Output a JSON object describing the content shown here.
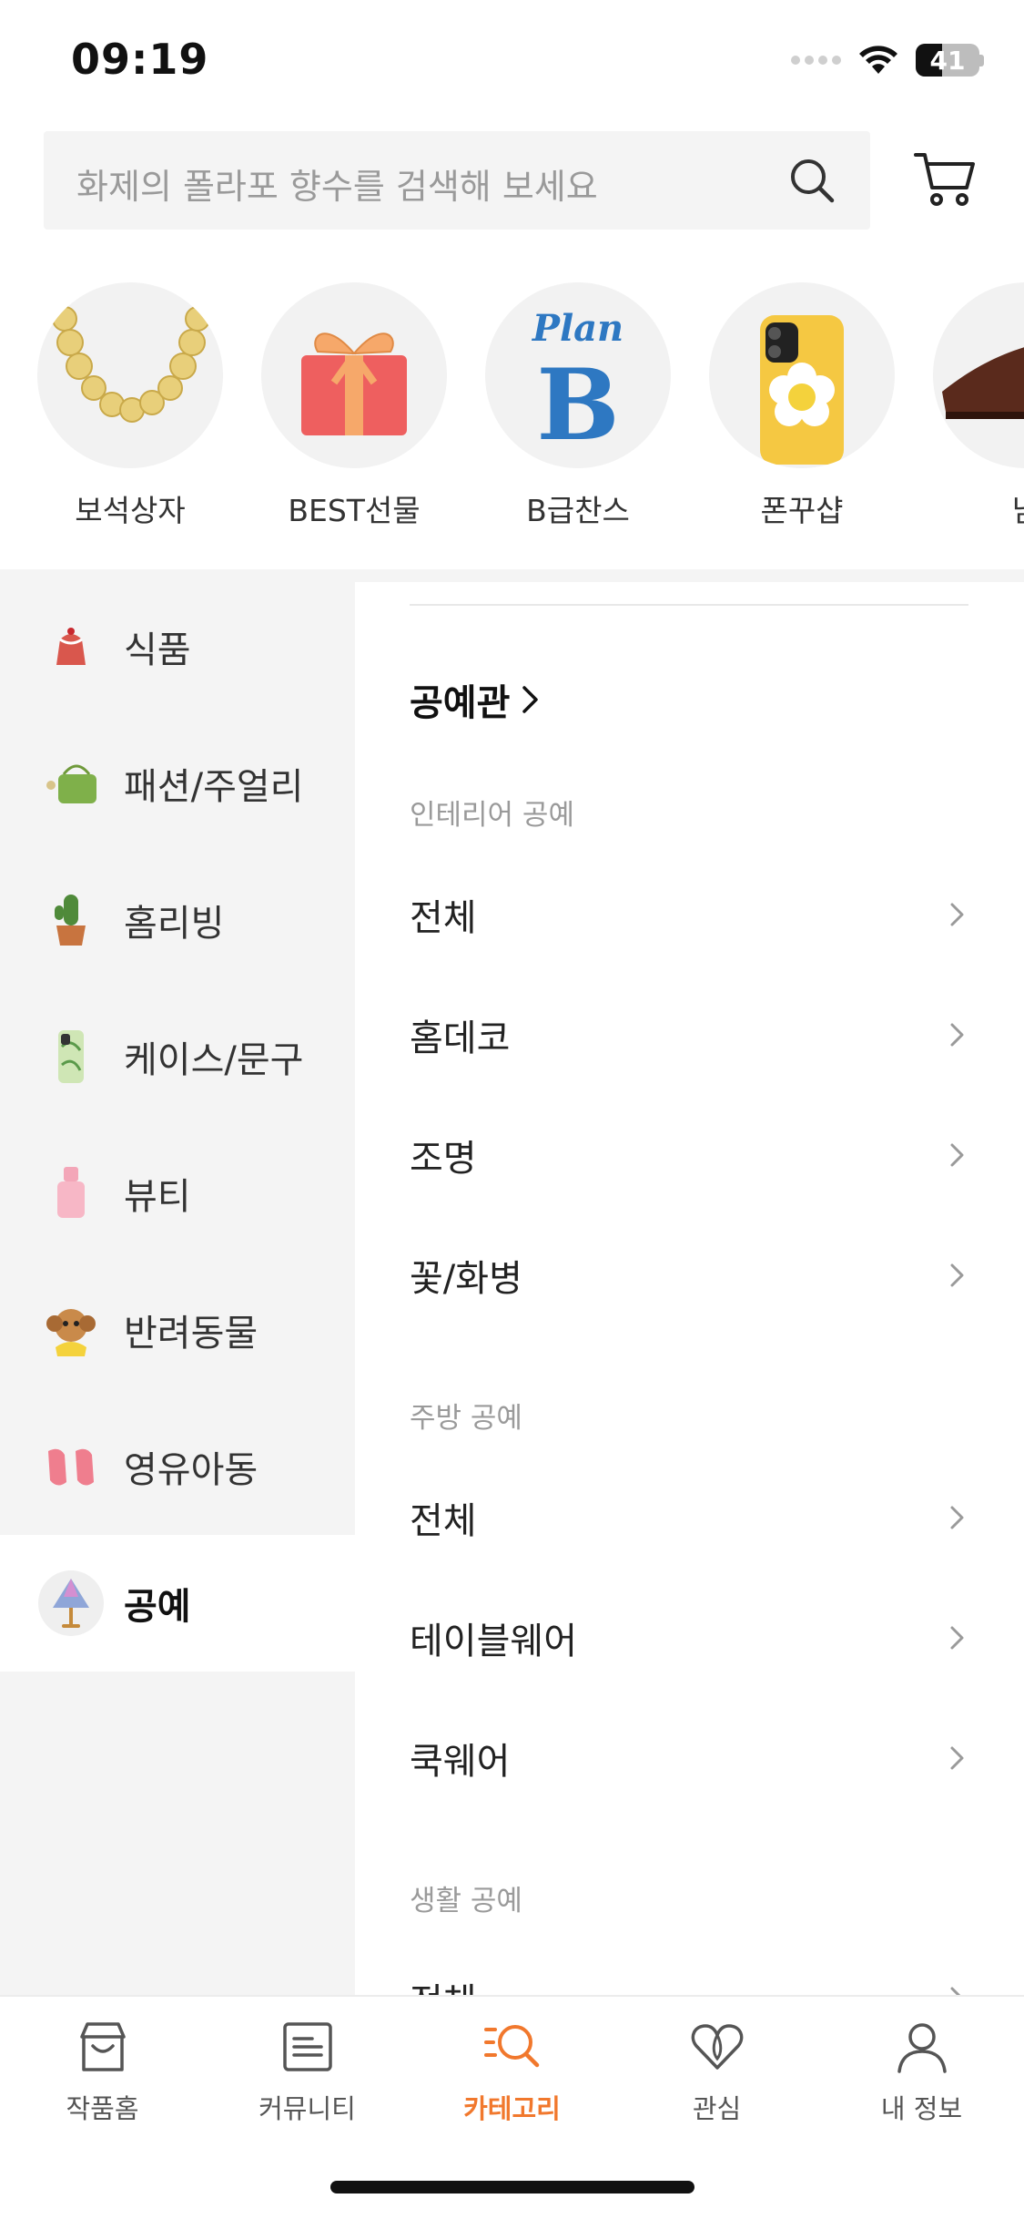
{
  "status_bar": {
    "time": "09:19",
    "battery": "41"
  },
  "search": {
    "placeholder": "화제의 폴라포 향수를 검색해 보세요"
  },
  "shortcuts": [
    {
      "label": "보석상자",
      "icon": "amber-necklace-icon"
    },
    {
      "label": "BEST선물",
      "icon": "gift-box-icon"
    },
    {
      "label": "B급찬스",
      "icon": "plan-b-logo-icon",
      "logo_text": "Plan B"
    },
    {
      "label": "폰꾸샵",
      "icon": "flower-phone-case-icon"
    },
    {
      "label": "남",
      "icon": "leather-shoe-icon"
    }
  ],
  "sidebar": {
    "items": [
      {
        "label": "식품",
        "icon": "cake-icon",
        "active": false
      },
      {
        "label": "패션/주얼리",
        "icon": "green-bag-icon",
        "active": false
      },
      {
        "label": "홈리빙",
        "icon": "cactus-pot-icon",
        "active": false
      },
      {
        "label": "케이스/문구",
        "icon": "phone-case-icon",
        "active": false
      },
      {
        "label": "뷰티",
        "icon": "perfume-bottle-icon",
        "active": false
      },
      {
        "label": "반려동물",
        "icon": "puppy-icon",
        "active": false
      },
      {
        "label": "영유아동",
        "icon": "baby-shoes-icon",
        "active": false
      },
      {
        "label": "공예",
        "icon": "lamp-craft-icon",
        "active": true
      }
    ]
  },
  "panel": {
    "hall_link": "공예관",
    "sections": [
      {
        "title": "인테리어 공예",
        "items": [
          "전체",
          "홈데코",
          "조명",
          "꽃/화병"
        ]
      },
      {
        "title": "주방 공예",
        "items": [
          "전체",
          "테이블웨어",
          "쿡웨어"
        ]
      },
      {
        "title": "생활 공예",
        "items": [
          "전체"
        ]
      }
    ]
  },
  "tabs": [
    {
      "label": "작품홈",
      "icon": "shop-icon",
      "active": false
    },
    {
      "label": "커뮤니티",
      "icon": "board-icon",
      "active": false
    },
    {
      "label": "카테고리",
      "icon": "category-search-icon",
      "active": true
    },
    {
      "label": "관심",
      "icon": "heart-icon",
      "active": false
    },
    {
      "label": "내 정보",
      "icon": "person-icon",
      "active": false
    }
  ],
  "colors": {
    "accent": "#f1782d",
    "sidebar_bg": "#f4f4f4",
    "search_bg": "#f4f4f4"
  }
}
